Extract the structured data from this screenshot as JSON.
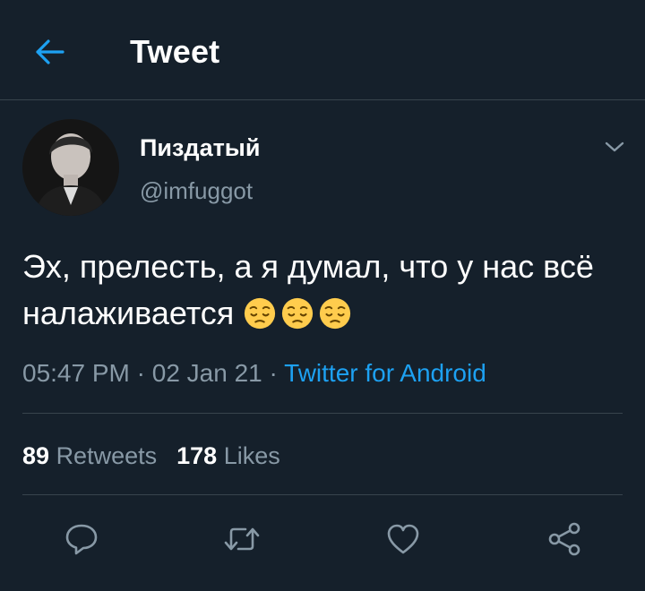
{
  "header": {
    "title": "Tweet",
    "back_icon": "arrow-left-icon",
    "accent_color": "#1da1f2"
  },
  "tweet": {
    "author": {
      "name": "Пиздатый",
      "handle": "@imfuggot"
    },
    "text": "Эх, прелесть, а я думал, что у нас всё налаживается",
    "emojis": [
      "pensive-face-emoji",
      "pensive-face-emoji",
      "pensive-face-emoji"
    ],
    "meta": {
      "time": "05:47 PM",
      "date": "02 Jan 21",
      "source": "Twitter for Android",
      "separator": "·"
    },
    "stats": {
      "retweets_count": "89",
      "retweets_label": "Retweets",
      "likes_count": "178",
      "likes_label": "Likes"
    },
    "actions": [
      {
        "icon": "reply-icon"
      },
      {
        "icon": "retweet-icon"
      },
      {
        "icon": "like-icon"
      },
      {
        "icon": "share-icon"
      }
    ]
  },
  "colors": {
    "background": "#15202b",
    "secondary_text": "#8899a6",
    "divider": "#38444d",
    "link": "#1da1f2"
  }
}
